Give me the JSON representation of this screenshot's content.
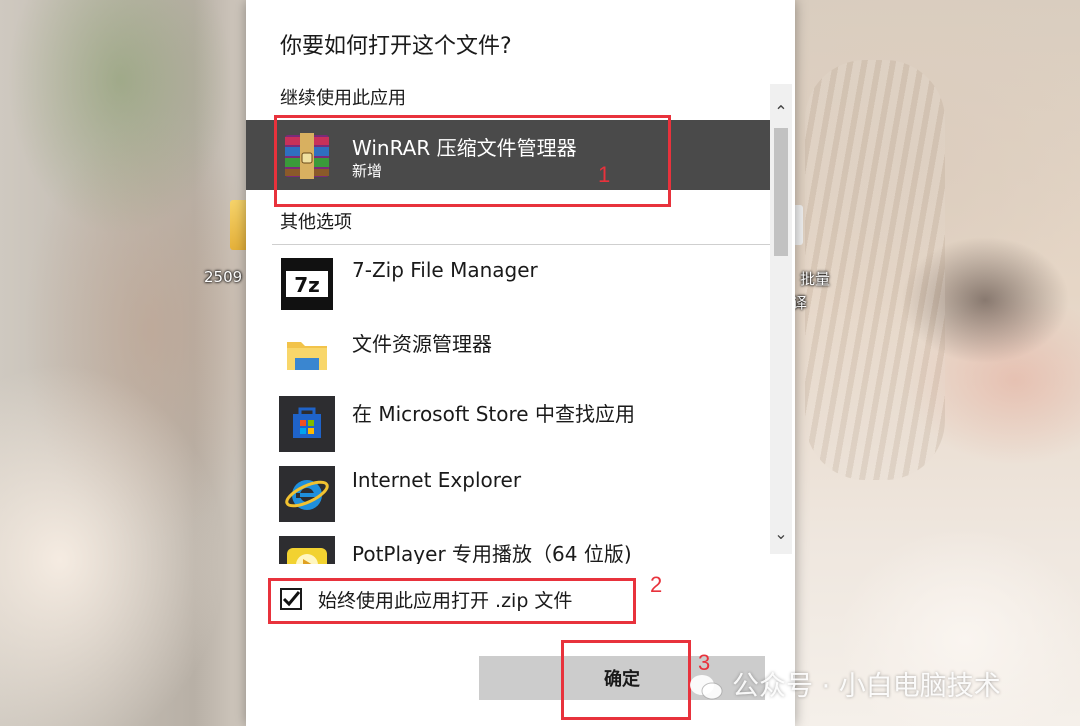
{
  "dialog": {
    "title": "你要如何打开这个文件?",
    "continue_label": "继续使用此应用",
    "other_label": "其他选项",
    "selected_app": {
      "name": "WinRAR 压缩文件管理器",
      "sub": "新增",
      "icon": "winrar-icon"
    },
    "apps": [
      {
        "name": "7-Zip File Manager",
        "icon": "7zip-icon"
      },
      {
        "name": "文件资源管理器",
        "icon": "file-explorer-icon"
      },
      {
        "name": "在 Microsoft Store 中查找应用",
        "icon": "microsoft-store-icon"
      },
      {
        "name": "Internet Explorer",
        "icon": "internet-explorer-icon"
      },
      {
        "name": "PotPlayer 专用播放（64 位版)",
        "icon": "potplayer-icon"
      }
    ],
    "always_use_label": "始终使用此应用打开 .zip 文件",
    "always_use_checked": true,
    "ok_label": "确定"
  },
  "desktop": {
    "icon_left_label": "2509",
    "icon_right_label": "批量",
    "icon_right_label2": "译"
  },
  "annotations": {
    "n1": "1",
    "n2": "2",
    "n3": "3",
    "color": "#e8323c"
  },
  "watermark": "公众号 · 小白电脑技术"
}
